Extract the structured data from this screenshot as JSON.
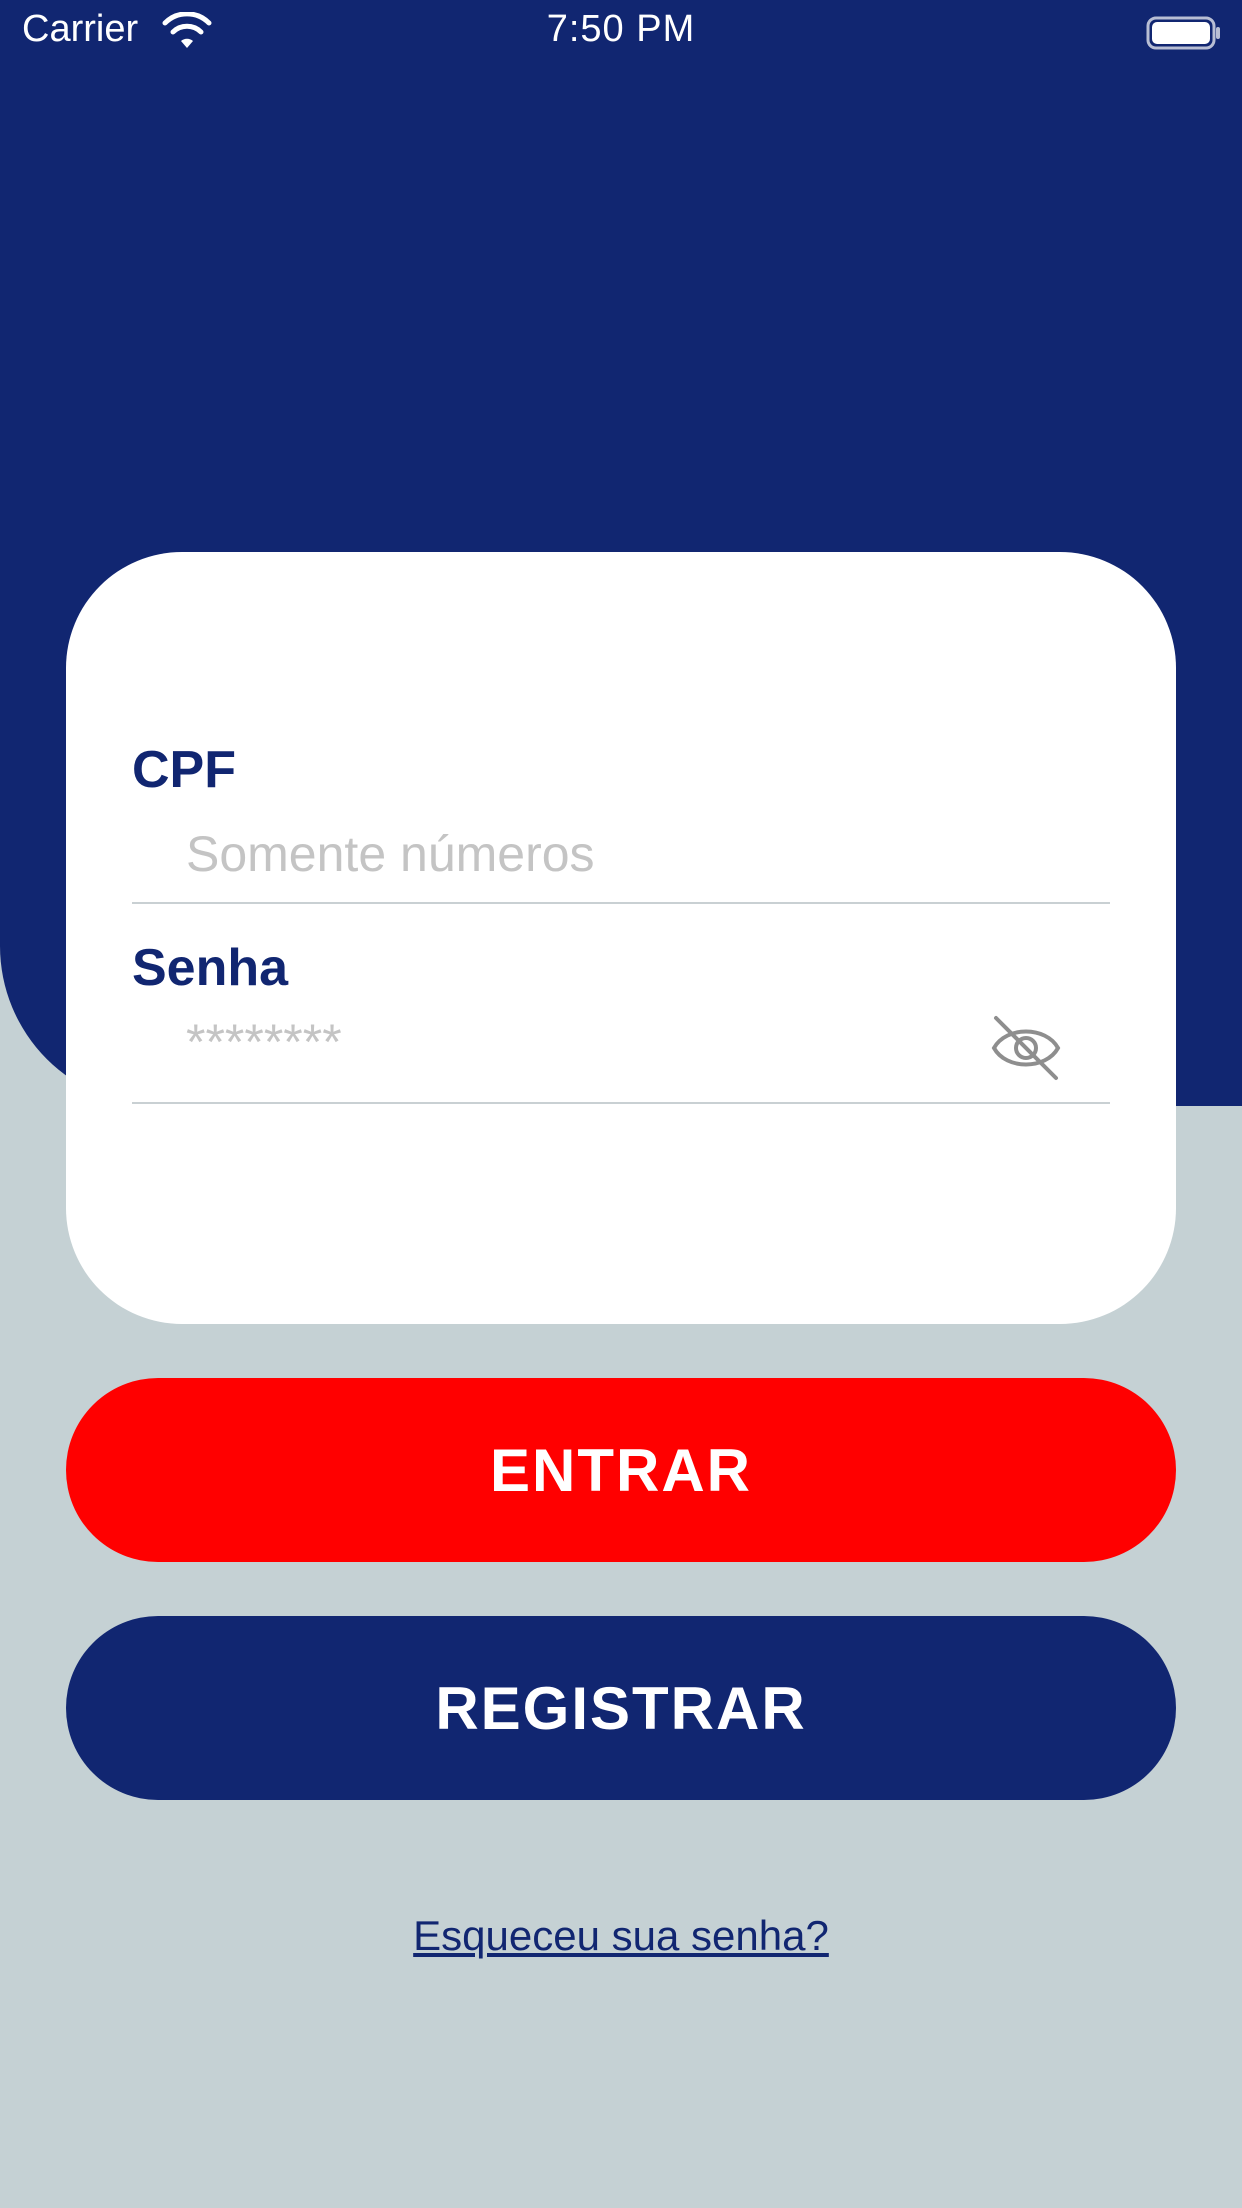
{
  "status_bar": {
    "carrier": "Carrier",
    "time": "7:50 PM",
    "wifi_icon": "wifi-icon",
    "battery_icon": "battery-full-icon"
  },
  "login_form": {
    "cpf": {
      "label": "CPF",
      "placeholder": "Somente números",
      "value": ""
    },
    "password": {
      "label": "Senha",
      "placeholder": "********",
      "value": "",
      "toggle_icon": "eye-slash-icon"
    }
  },
  "actions": {
    "login_label": "ENTRAR",
    "register_label": "REGISTRAR",
    "forgot_label": "Esqueceu sua senha?"
  },
  "colors": {
    "primary": "#112671",
    "accent": "#FF0000",
    "background": "#C5D1D4",
    "card": "#FFFFFF"
  }
}
